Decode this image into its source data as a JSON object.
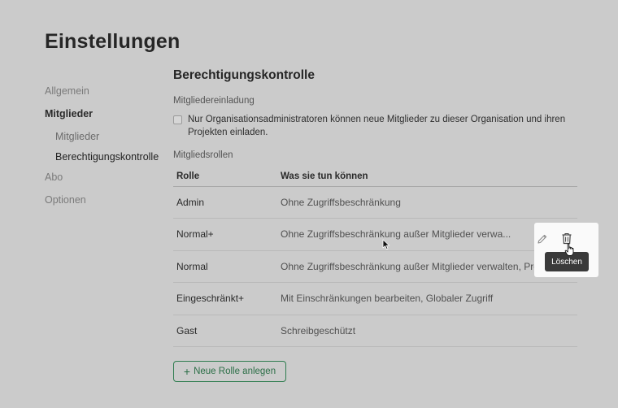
{
  "page": {
    "title": "Einstellungen"
  },
  "sidebar": {
    "items": [
      {
        "label": "Allgemein"
      },
      {
        "label": "Mitglieder"
      },
      {
        "label": "Mitglieder"
      },
      {
        "label": "Berechtigungskontrolle"
      },
      {
        "label": "Abo"
      },
      {
        "label": "Optionen"
      }
    ]
  },
  "main": {
    "section_title": "Berechtigungskontrolle",
    "invite": {
      "label": "Mitgliedereinladung",
      "checkbox_label": "Nur Organisationsadministratoren können neue Mitglieder zu dieser Organisation und ihren Projekten einladen.",
      "checked": false
    },
    "roles": {
      "label": "Mitgliedsrollen",
      "columns": [
        "Rolle",
        "Was sie tun können"
      ],
      "rows": [
        {
          "role": "Admin",
          "desc": "Ohne Zugriffsbeschränkung"
        },
        {
          "role": "Normal+",
          "desc": "Ohne Zugriffsbeschränkung außer Mitglieder verwa..."
        },
        {
          "role": "Normal",
          "desc": "Ohne Zugriffsbeschränkung außer Mitglieder verwalten, Proje..."
        },
        {
          "role": "Eingeschränkt+",
          "desc": "Mit Einschränkungen bearbeiten, Globaler Zugriff"
        },
        {
          "role": "Gast",
          "desc": "Schreibgeschützt"
        }
      ]
    },
    "new_role_button": {
      "icon": "plus-icon",
      "label": "Neue Rolle anlegen"
    },
    "row_actions": {
      "edit_icon": "pencil-icon",
      "delete_icon": "trash-icon",
      "tooltip": "Löschen"
    }
  },
  "colors": {
    "background": "#cbcbcb",
    "accent": "#2f7d4f",
    "popover": "#fafafa",
    "tooltip": "#3a3a3a"
  }
}
